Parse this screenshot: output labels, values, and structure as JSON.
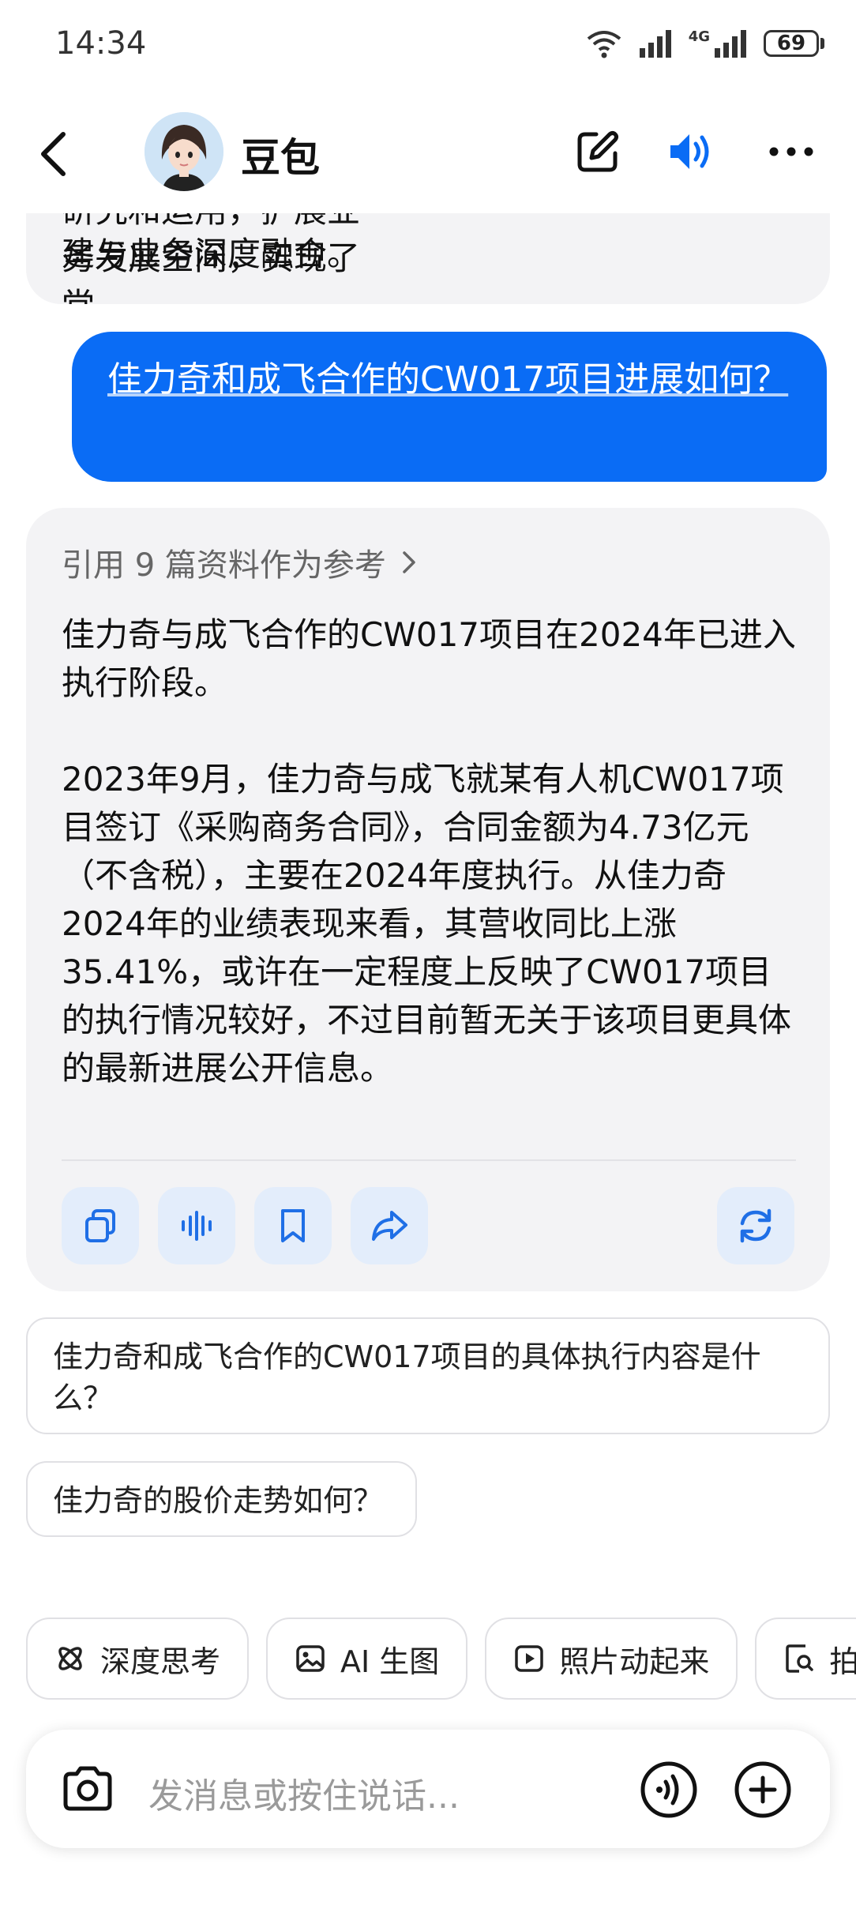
{
  "status_bar": {
    "time": "14:34",
    "network": "4G",
    "battery": "69"
  },
  "header": {
    "title": "豆包"
  },
  "conversation": {
    "previous_tail": "建与业务深度融合。",
    "previous_clipped": "研究和运用，扩展业务发展空间，实现了党",
    "user_message": "佳力奇和成飞合作的CW017项目进展如何？",
    "references_label": "引用 9 篇资料作为参考",
    "answer_paragraphs": [
      "佳力奇与成飞合作的CW017项目在2024年已进入执行阶段。",
      "2023年9月，佳力奇与成飞就某有人机CW017项目签订《采购商务合同》，合同金额为4.73亿元（不含税），主要在2024年度执行。从佳力奇2024年的业绩表现来看，其营收同比上涨35.41%，或许在一定程度上反映了CW017项目的执行情况较好，不过目前暂无关于该项目更具体的最新进展公开信息。"
    ]
  },
  "suggestions": [
    "佳力奇和成飞合作的CW017项目的具体执行内容是什么？",
    "佳力奇的股价走势如何？"
  ],
  "chips": [
    {
      "label": "深度思考",
      "icon": "atom-icon"
    },
    {
      "label": "AI 生图",
      "icon": "image-icon"
    },
    {
      "label": "照片动起来",
      "icon": "play-icon"
    },
    {
      "label": "拍",
      "icon": "scan-doc-icon"
    }
  ],
  "input": {
    "placeholder": "发消息或按住说话..."
  },
  "colors": {
    "accent": "#0a6cf5",
    "action_bg": "#e3edfb",
    "bubble_bg": "#f3f3f5"
  }
}
